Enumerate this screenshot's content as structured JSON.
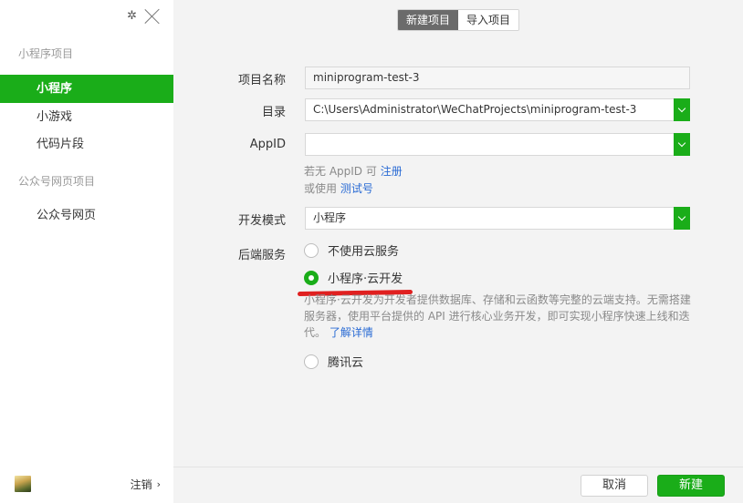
{
  "sidebar": {
    "section_miniprogram": "小程序项目",
    "items": [
      {
        "label": "小程序"
      },
      {
        "label": "小游戏"
      },
      {
        "label": "代码片段"
      }
    ],
    "section_official": "公众号网页项目",
    "official_item": "公众号网页",
    "logout_label": "注销",
    "logout_chevron": "›"
  },
  "tabs": {
    "new_project": "新建项目",
    "import_project": "导入项目",
    "active": "new_project"
  },
  "form": {
    "project_name_label": "项目名称",
    "project_name_value": "miniprogram-test-3",
    "directory_label": "目录",
    "directory_value": "C:\\Users\\Administrator\\WeChatProjects\\miniprogram-test-3",
    "appid_label": "AppID",
    "appid_value": "",
    "appid_hint_prefix": "若无 AppID 可",
    "appid_register_link": "注册",
    "appid_hint2_prefix": "或使用",
    "appid_test_link": "测试号",
    "dev_mode_label": "开发模式",
    "dev_mode_value": "小程序",
    "backend_label": "后端服务",
    "backend_options": [
      {
        "label": "不使用云服务",
        "selected": false
      },
      {
        "label": "小程序·云开发",
        "selected": true
      },
      {
        "label": "腾讯云",
        "selected": false
      }
    ],
    "cloud_desc": "小程序·云开发为开发者提供数据库、存储和云函数等完整的云端支持。无需搭建服务器，使用平台提供的 API 进行核心业务开发，即可实现小程序快速上线和迭代。",
    "cloud_desc_link": "了解详情"
  },
  "footer": {
    "cancel_label": "取消",
    "create_label": "新建"
  },
  "colors": {
    "accent": "#1aad19",
    "link": "#2a6bd4",
    "annotation": "#e02020"
  }
}
